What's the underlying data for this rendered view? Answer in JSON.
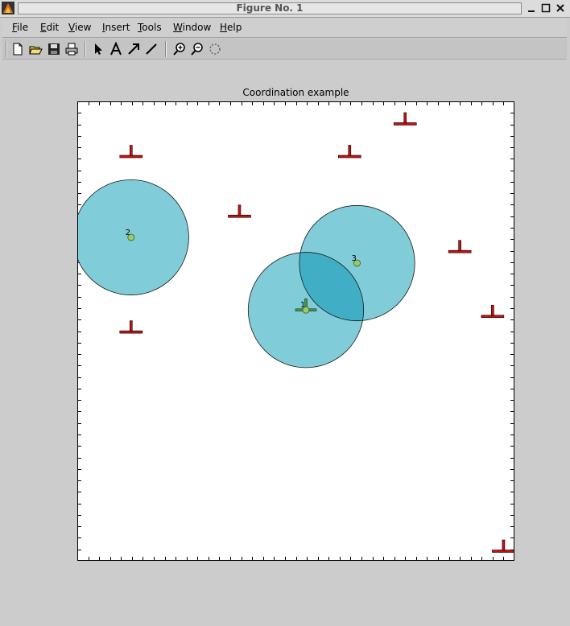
{
  "window": {
    "title": "Figure No. 1",
    "buttons": [
      "minimize",
      "maximize",
      "close"
    ]
  },
  "menubar": {
    "items": [
      {
        "label": "File"
      },
      {
        "label": "Edit"
      },
      {
        "label": "View"
      },
      {
        "label": "Insert"
      },
      {
        "label": "Tools"
      },
      {
        "label": "Window"
      },
      {
        "label": "Help"
      }
    ]
  },
  "toolbar": {
    "buttons": [
      "new-figure-icon",
      "open-folder-icon",
      "save-icon",
      "print-icon",
      "select-arrow-icon",
      "insert-text-icon",
      "insert-arrow-icon",
      "insert-line-icon",
      "zoom-in-icon",
      "zoom-out-icon",
      "rotate-icon"
    ]
  },
  "figure": {
    "title": "Coordination example",
    "colors": {
      "background": "#ffffff",
      "circle_fill": "#80ccd8",
      "circle_overlap": "#40afc6",
      "circle_stroke": "#1a1a1a",
      "marker_red": "#cc1111",
      "point_green": "#9ccc66",
      "robot_green": "#4c8c4c"
    },
    "axes": {
      "xlim": [
        0,
        100
      ],
      "ylim": [
        0,
        100
      ],
      "ticks_every": 2.5,
      "tick_labels": false
    },
    "agents": [
      {
        "id": "1",
        "x": 52.3,
        "y": 54.6,
        "radius": 13.2
      },
      {
        "id": "2",
        "x": 12.3,
        "y": 70.4,
        "radius": 13.2
      },
      {
        "id": "3",
        "x": 64.0,
        "y": 64.8,
        "radius": 13.2
      }
    ],
    "targets": [
      {
        "x": 12.3,
        "y": 88.0
      },
      {
        "x": 37.1,
        "y": 75.0
      },
      {
        "x": 62.3,
        "y": 88.0
      },
      {
        "x": 75.0,
        "y": 95.1
      },
      {
        "x": 87.5,
        "y": 67.3
      },
      {
        "x": 95.0,
        "y": 53.2
      },
      {
        "x": 12.3,
        "y": 49.8
      },
      {
        "x": 97.5,
        "y": 2.1
      }
    ]
  }
}
